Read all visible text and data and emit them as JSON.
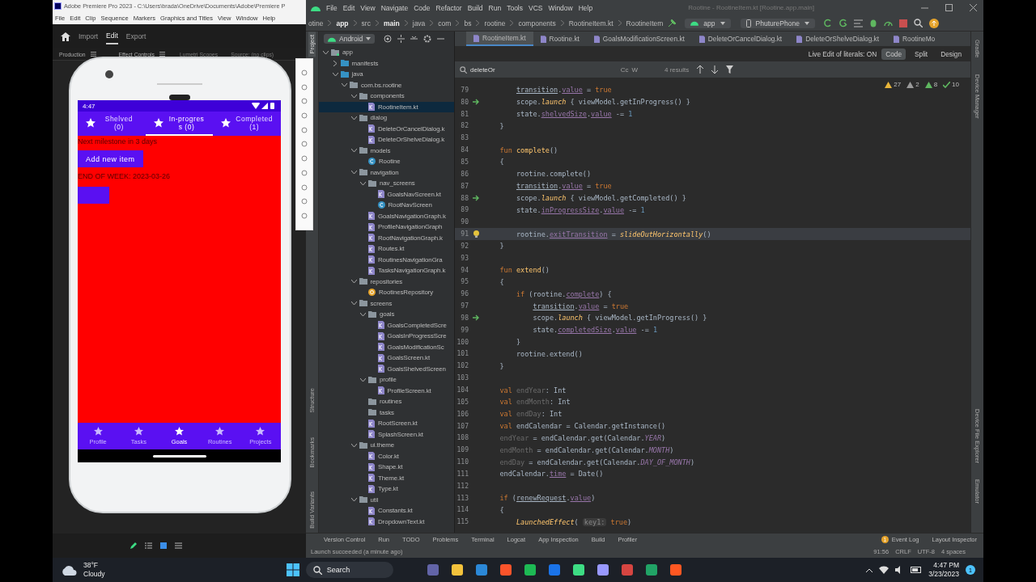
{
  "premiere": {
    "title": "Adobe Premiere Pro 2023 - C:\\Users\\brada\\OneDrive\\Documents\\Adobe\\Premiere P",
    "menu": [
      "File",
      "Edit",
      "Clip",
      "Sequence",
      "Markers",
      "Graphics and Titles",
      "View",
      "Window",
      "Help"
    ],
    "workspace_tabs": [
      {
        "label": "Import",
        "selected": false
      },
      {
        "label": "Edit",
        "selected": true
      },
      {
        "label": "Export",
        "selected": false
      }
    ],
    "panels": [
      {
        "label": "Production",
        "menu": true
      },
      {
        "label": "Effect Controls",
        "menu": true
      },
      {
        "label": "Lumetri Scopes",
        "menu": false
      },
      {
        "label": "Source: (no clips)",
        "menu": false
      }
    ]
  },
  "emulator": {
    "time": "4:47",
    "tabs": [
      {
        "label": "Shelved (0)",
        "selected": false
      },
      {
        "label": "In-progress (0)",
        "selected": true
      },
      {
        "label": "Completed (1)",
        "selected": false
      }
    ],
    "milestone": "Next milestone in 3 days",
    "add_button": "Add new item",
    "end_of_week": "END OF WEEK: 2023-03-26",
    "nav": [
      {
        "label": "Profile",
        "selected": false
      },
      {
        "label": "Tasks",
        "selected": false
      },
      {
        "label": "Goals",
        "selected": true
      },
      {
        "label": "Routines",
        "selected": false
      },
      {
        "label": "Projects",
        "selected": false
      }
    ]
  },
  "studio": {
    "menu": [
      "File",
      "Edit",
      "View",
      "Navigate",
      "Code",
      "Refactor",
      "Build",
      "Run",
      "Tools",
      "VCS",
      "Window",
      "Help"
    ],
    "title": "Rootine - RootineItem.kt [Rootine.app.main]",
    "breadcrumbs": [
      "otine",
      "app",
      "src",
      "main",
      "java",
      "com",
      "bs",
      "rootine",
      "components",
      "RootineItem.kt",
      "RootineItem"
    ],
    "run_config": "app",
    "device": "PhuturePhone",
    "project_view": "Android",
    "editor_tabs": [
      {
        "label": "RootineItem.kt",
        "selected": true
      },
      {
        "label": "Rootine.kt",
        "selected": false
      },
      {
        "label": "GoalsModificationScreen.kt",
        "selected": false
      },
      {
        "label": "DeleteOrCancelDialog.kt",
        "selected": false
      },
      {
        "label": "DeleteOrShelveDialog.kt",
        "selected": false
      },
      {
        "label": "RootineMo",
        "selected": false
      }
    ],
    "live_edit": "Live Edit of literals: ON",
    "view_modes": [
      {
        "label": "Code",
        "selected": true
      },
      {
        "label": "Split",
        "selected": false
      },
      {
        "label": "Design",
        "selected": false
      }
    ],
    "search": {
      "value": "deleteOr",
      "options": [
        "Cc",
        "W"
      ],
      "results": "4 results"
    },
    "inspections": [
      {
        "kind": "warning",
        "count": "27"
      },
      {
        "kind": "weak",
        "count": "2"
      },
      {
        "kind": "typo",
        "count": "8"
      },
      {
        "kind": "ok",
        "count": "10"
      }
    ],
    "tree": [
      {
        "label": "app",
        "kind": "module",
        "expanded": true,
        "selected": false,
        "children": [
          {
            "label": "manifests",
            "kind": "source",
            "expanded": false,
            "selected": false
          },
          {
            "label": "java",
            "kind": "source",
            "expanded": true,
            "selected": false,
            "children": [
              {
                "label": "com.bs.rootine",
                "kind": "package",
                "expanded": true,
                "selected": false,
                "children": [
                  {
                    "label": "components",
                    "kind": "package",
                    "expanded": true,
                    "selected": false,
                    "children": [
                      {
                        "label": "RootineItem.kt",
                        "kind": "kotlin",
                        "selected": true
                      }
                    ]
                  },
                  {
                    "label": "dialog",
                    "kind": "package",
                    "expanded": true,
                    "selected": false,
                    "children": [
                      {
                        "label": "DeleteOrCancelDialog.k",
                        "kind": "kotlin",
                        "selected": false
                      },
                      {
                        "label": "DeleteOrShelveDialog.k",
                        "kind": "kotlin",
                        "selected": false
                      }
                    ]
                  },
                  {
                    "label": "models",
                    "kind": "package",
                    "expanded": true,
                    "selected": false,
                    "children": [
                      {
                        "label": "Rootine",
                        "kind": "class",
                        "selected": false
                      }
                    ]
                  },
                  {
                    "label": "navigation",
                    "kind": "package",
                    "expanded": true,
                    "selected": false,
                    "children": [
                      {
                        "label": "nav_screens",
                        "kind": "package",
                        "expanded": true,
                        "selected": false,
                        "children": [
                          {
                            "label": "GoalsNavScreen.kt",
                            "kind": "kotlin",
                            "selected": false
                          },
                          {
                            "label": "RootNavScreen",
                            "kind": "class",
                            "selected": false
                          }
                        ]
                      },
                      {
                        "label": "GoalsNavigationGraph.k",
                        "kind": "kotlin",
                        "selected": false
                      },
                      {
                        "label": "ProfileNavigationGraph",
                        "kind": "kotlin",
                        "selected": false
                      },
                      {
                        "label": "RootNavigationGraph.k",
                        "kind": "kotlin",
                        "selected": false
                      },
                      {
                        "label": "Routes.kt",
                        "kind": "kotlin",
                        "selected": false
                      },
                      {
                        "label": "RoutinesNavigationGra",
                        "kind": "kotlin",
                        "selected": false
                      },
                      {
                        "label": "TasksNavigationGraph.k",
                        "kind": "kotlin",
                        "selected": false
                      }
                    ]
                  },
                  {
                    "label": "repositories",
                    "kind": "package",
                    "expanded": true,
                    "selected": false,
                    "children": [
                      {
                        "label": "RootinesRepository",
                        "kind": "object",
                        "selected": false
                      }
                    ]
                  },
                  {
                    "label": "screens",
                    "kind": "package",
                    "expanded": true,
                    "selected": false,
                    "children": [
                      {
                        "label": "goals",
                        "kind": "package",
                        "expanded": true,
                        "selected": false,
                        "children": [
                          {
                            "label": "GoalsCompletedScre",
                            "kind": "kotlin",
                            "selected": false
                          },
                          {
                            "label": "GoalsInProgressScre",
                            "kind": "kotlin",
                            "selected": false
                          },
                          {
                            "label": "GoalsModificationSc",
                            "kind": "kotlin",
                            "selected": false
                          },
                          {
                            "label": "GoalsScreen.kt",
                            "kind": "kotlin",
                            "selected": false
                          },
                          {
                            "label": "GoalsShelvedScreen",
                            "kind": "kotlin",
                            "selected": false
                          }
                        ]
                      },
                      {
                        "label": "profile",
                        "kind": "package",
                        "expanded": true,
                        "selected": false,
                        "children": [
                          {
                            "label": "ProfileScreen.kt",
                            "kind": "kotlin",
                            "selected": false
                          }
                        ]
                      },
                      {
                        "label": "routines",
                        "kind": "package",
                        "selected": false
                      },
                      {
                        "label": "tasks",
                        "kind": "package",
                        "selected": false
                      },
                      {
                        "label": "RootScreen.kt",
                        "kind": "kotlin",
                        "selected": false
                      },
                      {
                        "label": "SplashScreen.kt",
                        "kind": "kotlin",
                        "selected": false
                      }
                    ]
                  },
                  {
                    "label": "ui.theme",
                    "kind": "package",
                    "expanded": true,
                    "selected": false,
                    "children": [
                      {
                        "label": "Color.kt",
                        "kind": "kotlin",
                        "selected": false
                      },
                      {
                        "label": "Shape.kt",
                        "kind": "kotlin",
                        "selected": false
                      },
                      {
                        "label": "Theme.kt",
                        "kind": "kotlin",
                        "selected": false
                      },
                      {
                        "label": "Type.kt",
                        "kind": "kotlin",
                        "selected": false
                      }
                    ]
                  },
                  {
                    "label": "util",
                    "kind": "package",
                    "expanded": true,
                    "selected": false,
                    "children": [
                      {
                        "label": "Constants.kt",
                        "kind": "kotlin",
                        "selected": false
                      },
                      {
                        "label": "DropdownText.kt",
                        "kind": "kotlin",
                        "selected": false
                      }
                    ]
                  }
                ]
              }
            ]
          }
        ]
      }
    ],
    "code": [
      {
        "n": "79",
        "parts": [
          {
            "kind": "u",
            "text": "        transition"
          },
          {
            "kind": "pl",
            "text": "."
          },
          {
            "kind": "prop",
            "text": "value"
          },
          {
            "kind": "pl",
            "text": " = "
          },
          {
            "kind": "kw",
            "text": "true"
          }
        ]
      },
      {
        "n": "80",
        "kind": "run",
        "parts": [
          {
            "kind": "pl",
            "text": "        scope."
          },
          {
            "kind": "it",
            "text": "launch"
          },
          {
            "kind": "pl",
            "text": " { viewModel.getInProgress() }"
          }
        ]
      },
      {
        "n": "81",
        "parts": [
          {
            "kind": "pl",
            "text": "        state."
          },
          {
            "kind": "prop",
            "text": "shelvedSize"
          },
          {
            "kind": "pl",
            "text": "."
          },
          {
            "kind": "prop",
            "text": "value"
          },
          {
            "kind": "pl",
            "text": " -= "
          },
          {
            "kind": "num",
            "text": "1"
          }
        ]
      },
      {
        "n": "82",
        "parts": [
          {
            "kind": "pl",
            "text": "    }"
          }
        ]
      },
      {
        "n": "83"
      },
      {
        "n": "84",
        "parts": [
          {
            "kind": "kw",
            "text": "    fun "
          },
          {
            "kind": "fn",
            "text": "complete"
          },
          {
            "kind": "pl",
            "text": "()"
          }
        ]
      },
      {
        "n": "85",
        "parts": [
          {
            "kind": "pl",
            "text": "    {"
          }
        ]
      },
      {
        "n": "86",
        "parts": [
          {
            "kind": "pl",
            "text": "        rootine.complete()"
          }
        ]
      },
      {
        "n": "87",
        "parts": [
          {
            "kind": "u",
            "text": "        transition"
          },
          {
            "kind": "pl",
            "text": "."
          },
          {
            "kind": "prop",
            "text": "value"
          },
          {
            "kind": "pl",
            "text": " = "
          },
          {
            "kind": "kw",
            "text": "true"
          }
        ]
      },
      {
        "n": "88",
        "kind": "run",
        "parts": [
          {
            "kind": "pl",
            "text": "        scope."
          },
          {
            "kind": "it",
            "text": "launch"
          },
          {
            "kind": "pl",
            "text": " { viewModel.getCompleted() }"
          }
        ]
      },
      {
        "n": "89",
        "parts": [
          {
            "kind": "pl",
            "text": "        state."
          },
          {
            "kind": "prop",
            "text": "inProgressSize"
          },
          {
            "kind": "pl",
            "text": "."
          },
          {
            "kind": "prop",
            "text": "value"
          },
          {
            "kind": "pl",
            "text": " -= "
          },
          {
            "kind": "num",
            "text": "1"
          }
        ]
      },
      {
        "n": "90"
      },
      {
        "n": "91",
        "kind": "bulb",
        "current": true,
        "parts": [
          {
            "kind": "pl",
            "text": "        rootine."
          },
          {
            "kind": "prop",
            "text": "exitTransition"
          },
          {
            "kind": "pl",
            "text": " = "
          },
          {
            "kind": "it",
            "text": "slideOutHorizontally"
          },
          {
            "kind": "pl",
            "text": "()"
          }
        ]
      },
      {
        "n": "92",
        "parts": [
          {
            "kind": "pl",
            "text": "    }"
          }
        ]
      },
      {
        "n": "93"
      },
      {
        "n": "94",
        "parts": [
          {
            "kind": "kw",
            "text": "    fun "
          },
          {
            "kind": "fn",
            "text": "extend"
          },
          {
            "kind": "pl",
            "text": "()"
          }
        ]
      },
      {
        "n": "95",
        "parts": [
          {
            "kind": "pl",
            "text": "    {"
          }
        ]
      },
      {
        "n": "96",
        "parts": [
          {
            "kind": "kw",
            "text": "        if"
          },
          {
            "kind": "pl",
            "text": " (rootine."
          },
          {
            "kind": "prop",
            "text": "complete"
          },
          {
            "kind": "pl",
            "text": ") {"
          }
        ]
      },
      {
        "n": "97",
        "parts": [
          {
            "kind": "u",
            "text": "            transition"
          },
          {
            "kind": "pl",
            "text": "."
          },
          {
            "kind": "prop",
            "text": "value"
          },
          {
            "kind": "pl",
            "text": " = "
          },
          {
            "kind": "kw",
            "text": "true"
          }
        ]
      },
      {
        "n": "98",
        "kind": "run",
        "parts": [
          {
            "kind": "pl",
            "text": "            scope."
          },
          {
            "kind": "it",
            "text": "launch"
          },
          {
            "kind": "pl",
            "text": " { viewModel.getInProgress() }"
          }
        ]
      },
      {
        "n": "99",
        "parts": [
          {
            "kind": "pl",
            "text": "            state."
          },
          {
            "kind": "prop",
            "text": "completedSize"
          },
          {
            "kind": "pl",
            "text": "."
          },
          {
            "kind": "prop",
            "text": "value"
          },
          {
            "kind": "pl",
            "text": " -= "
          },
          {
            "kind": "num",
            "text": "1"
          }
        ]
      },
      {
        "n": "100",
        "parts": [
          {
            "kind": "pl",
            "text": "        }"
          }
        ]
      },
      {
        "n": "101",
        "parts": [
          {
            "kind": "pl",
            "text": "        rootine.extend()"
          }
        ]
      },
      {
        "n": "102",
        "parts": [
          {
            "kind": "pl",
            "text": "    }"
          }
        ]
      },
      {
        "n": "103"
      },
      {
        "n": "104",
        "parts": [
          {
            "kind": "kw",
            "text": "    val "
          },
          {
            "kind": "dim",
            "text": "endYear"
          },
          {
            "kind": "pl",
            "text": ": Int"
          }
        ]
      },
      {
        "n": "105",
        "parts": [
          {
            "kind": "kw",
            "text": "    val "
          },
          {
            "kind": "dim",
            "text": "endMonth"
          },
          {
            "kind": "pl",
            "text": ": Int"
          }
        ]
      },
      {
        "n": "106",
        "parts": [
          {
            "kind": "kw",
            "text": "    val "
          },
          {
            "kind": "dim",
            "text": "endDay"
          },
          {
            "kind": "pl",
            "text": ": Int"
          }
        ]
      },
      {
        "n": "107",
        "parts": [
          {
            "kind": "kw",
            "text": "    val "
          },
          {
            "kind": "pl",
            "text": "endCalendar = Calendar.getInstance()"
          }
        ]
      },
      {
        "n": "108",
        "parts": [
          {
            "kind": "dim",
            "text": "    endYear"
          },
          {
            "kind": "pl",
            "text": " = endCalendar.get(Calendar."
          },
          {
            "kind": "itp",
            "text": "YEAR"
          },
          {
            "kind": "pl",
            "text": ")"
          }
        ]
      },
      {
        "n": "109",
        "parts": [
          {
            "kind": "dim",
            "text": "    endMonth"
          },
          {
            "kind": "pl",
            "text": " = endCalendar.get(Calendar."
          },
          {
            "kind": "itp",
            "text": "MONTH"
          },
          {
            "kind": "pl",
            "text": ")"
          }
        ]
      },
      {
        "n": "110",
        "parts": [
          {
            "kind": "dim",
            "text": "    endDay"
          },
          {
            "kind": "pl",
            "text": " = endCalendar.get(Calendar."
          },
          {
            "kind": "itp",
            "text": "DAY_OF_MONTH"
          },
          {
            "kind": "pl",
            "text": ")"
          }
        ]
      },
      {
        "n": "111",
        "parts": [
          {
            "kind": "pl",
            "text": "    endCalendar."
          },
          {
            "kind": "prop",
            "text": "time"
          },
          {
            "kind": "pl",
            "text": " = Date()"
          }
        ]
      },
      {
        "n": "112"
      },
      {
        "n": "113",
        "parts": [
          {
            "kind": "kw",
            "text": "    if"
          },
          {
            "kind": "pl",
            "text": " ("
          },
          {
            "kind": "u",
            "text": "renewRequest"
          },
          {
            "kind": "pl",
            "text": "."
          },
          {
            "kind": "prop",
            "text": "value"
          },
          {
            "kind": "pl",
            "text": ")"
          }
        ]
      },
      {
        "n": "114",
        "parts": [
          {
            "kind": "pl",
            "text": "    {"
          }
        ]
      },
      {
        "n": "115",
        "parts": [
          {
            "kind": "it",
            "text": "        LaunchedEffect"
          },
          {
            "kind": "pl",
            "text": "( "
          },
          {
            "kind": "hint",
            "text": "key1:"
          },
          {
            "kind": "kw",
            "text": " true"
          },
          {
            "kind": "pl",
            "text": ")"
          }
        ]
      }
    ],
    "side_tools_left": [
      {
        "label": "Project",
        "selected": true
      },
      {
        "label": "Structure",
        "selected": false
      },
      {
        "label": "Bookmarks",
        "selected": false
      },
      {
        "label": "Build Variants",
        "selected": false
      }
    ],
    "side_tools_right": [
      "Gradle",
      "Device Manager",
      "Device File Explorer",
      "Emulator"
    ],
    "tool_windows": [
      "Version Control",
      "Run",
      "TODO",
      "Problems",
      "Terminal",
      "Logcat",
      "App Inspection",
      "Build",
      "Profiler"
    ],
    "event_count": "1",
    "tool_windows_right": [
      "Event Log",
      "Layout Inspector"
    ],
    "status": "Launch succeeded (a minute ago)",
    "status_right": [
      "91:56",
      "CRLF",
      "UTF-8",
      "4 spaces"
    ]
  },
  "taskbar": {
    "temperature": "38°F",
    "weather": "Cloudy",
    "search": "Search",
    "time": "4:47 PM",
    "date": "3/23/2023",
    "notifications": "1"
  }
}
